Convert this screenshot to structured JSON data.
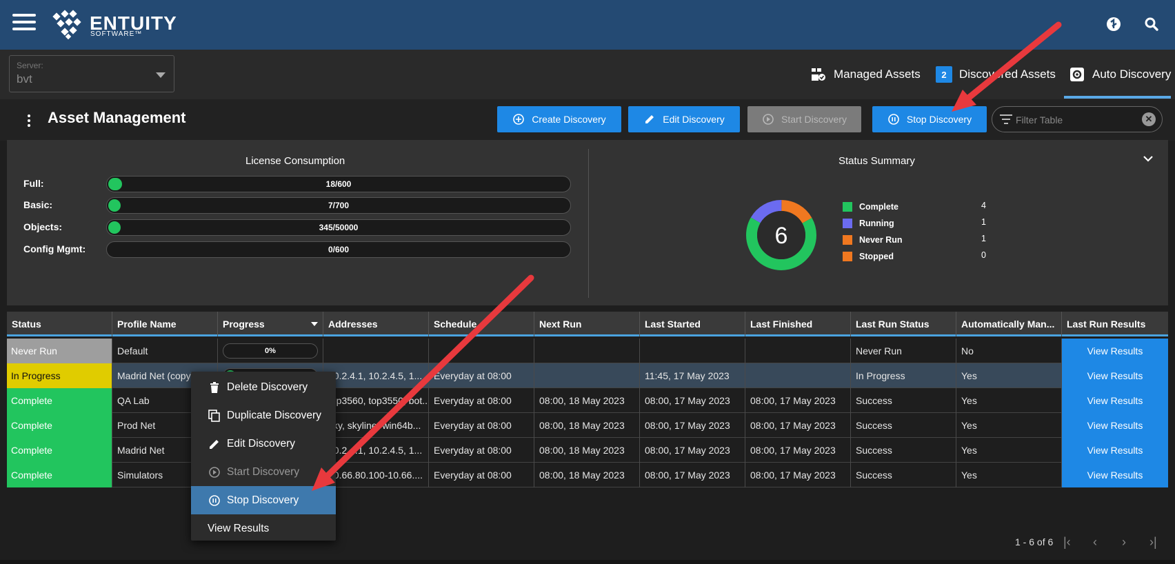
{
  "app": {
    "logo_name": "ENTUITY",
    "logo_sub": "SOFTWARE™"
  },
  "server": {
    "label": "Server:",
    "value": "bvt"
  },
  "nav_tabs": [
    {
      "label": "Managed Assets",
      "icon": "managed-assets-icon"
    },
    {
      "label": "Discovered Assets",
      "badge": "2"
    },
    {
      "label": "Auto Discovery",
      "icon": "auto-discovery-gear-icon",
      "active": true
    }
  ],
  "page": {
    "title": "Asset Management"
  },
  "toolbar": {
    "create": "Create Discovery",
    "edit": "Edit Discovery",
    "start": "Start Discovery",
    "stop": "Stop Discovery",
    "filter_placeholder": "Filter Table",
    "filter_clear": "✕"
  },
  "license": {
    "title": "License Consumption",
    "rows": [
      {
        "label": "Full:",
        "text": "18/600",
        "used": 18,
        "total": 600
      },
      {
        "label": "Basic:",
        "text": "7/700",
        "used": 7,
        "total": 700
      },
      {
        "label": "Objects:",
        "text": "345/50000",
        "used": 345,
        "total": 50000
      },
      {
        "label": "Config Mgmt:",
        "text": "0/600",
        "used": 0,
        "total": 600
      }
    ]
  },
  "status_summary": {
    "title": "Status Summary",
    "total": "6",
    "items": [
      {
        "label": "Complete",
        "count": "4",
        "color": "#22c55e"
      },
      {
        "label": "Running",
        "count": "1",
        "color": "#6b6bf0"
      },
      {
        "label": "Never Run",
        "count": "1",
        "color": "#f07820"
      },
      {
        "label": "Stopped",
        "count": "0",
        "color": "#f07820"
      }
    ]
  },
  "table": {
    "columns": [
      "Status",
      "Profile Name",
      "Progress",
      "Addresses",
      "Schedule",
      "Next Run",
      "Last Started",
      "Last Finished",
      "Last Run Status",
      "Automatically Man...",
      "Last Run Results"
    ],
    "rows": [
      {
        "status": "Never Run",
        "status_color": "#9e9e9e",
        "profile": "Default",
        "progress": "0%",
        "addresses": "",
        "schedule": "",
        "next_run": "",
        "last_started": "",
        "last_finished": "",
        "last_run_status": "Never Run",
        "auto": "No",
        "results": "View Results"
      },
      {
        "status": "In Progress",
        "status_color": "#e0cc00",
        "profile": "Madrid Net (copy)",
        "progress": "",
        "addresses": "10.2.4.1, 10.2.4.5, 1...",
        "schedule": "Everyday at 08:00",
        "next_run": "",
        "last_started": "11:45, 17 May 2023",
        "last_finished": "",
        "last_run_status": "In Progress",
        "auto": "Yes",
        "results": "View Results"
      },
      {
        "status": "Complete",
        "status_color": "#22c55e",
        "profile": "QA Lab",
        "progress": "",
        "addresses": "top3560, top3550, bot...",
        "schedule": "Everyday at 08:00",
        "next_run": "08:00, 18 May 2023",
        "last_started": "08:00, 17 May 2023",
        "last_finished": "08:00, 17 May 2023",
        "last_run_status": "Success",
        "auto": "Yes",
        "results": "View Results"
      },
      {
        "status": "Complete",
        "status_color": "#22c55e",
        "profile": "Prod Net",
        "progress": "",
        "addresses": "sky, skyline, win64b...",
        "schedule": "Everyday at 08:00",
        "next_run": "08:00, 18 May 2023",
        "last_started": "08:00, 17 May 2023",
        "last_finished": "08:00, 17 May 2023",
        "last_run_status": "Success",
        "auto": "Yes",
        "results": "View Results"
      },
      {
        "status": "Complete",
        "status_color": "#22c55e",
        "profile": "Madrid Net",
        "progress": "",
        "addresses": "10.2.4.1, 10.2.4.5, 1...",
        "schedule": "Everyday at 08:00",
        "next_run": "08:00, 18 May 2023",
        "last_started": "08:00, 17 May 2023",
        "last_finished": "08:00, 17 May 2023",
        "last_run_status": "Success",
        "auto": "Yes",
        "results": "View Results"
      },
      {
        "status": "Complete",
        "status_color": "#22c55e",
        "profile": "Simulators",
        "progress": "",
        "addresses": "10.66.80.100-10.66....",
        "schedule": "Everyday at 08:00",
        "next_run": "08:00, 18 May 2023",
        "last_started": "08:00, 17 May 2023",
        "last_finished": "08:00, 17 May 2023",
        "last_run_status": "Success",
        "auto": "Yes",
        "results": "View Results"
      }
    ]
  },
  "pagination": {
    "text": "1 - 6 of 6"
  },
  "context_menu": {
    "items": [
      {
        "label": "Delete Discovery",
        "icon": "trash-icon"
      },
      {
        "label": "Duplicate Discovery",
        "icon": "copy-icon"
      },
      {
        "label": "Edit Discovery",
        "icon": "pencil-icon"
      },
      {
        "label": "Start Discovery",
        "icon": "play-circle-icon",
        "disabled": true
      },
      {
        "label": "Stop Discovery",
        "icon": "pause-circle-icon",
        "highlighted": true
      },
      {
        "label": "View Results"
      }
    ]
  },
  "colors": {
    "topbar": "#244a73",
    "accent": "#1e88e5",
    "annotation_arrow": "#e8393d"
  }
}
